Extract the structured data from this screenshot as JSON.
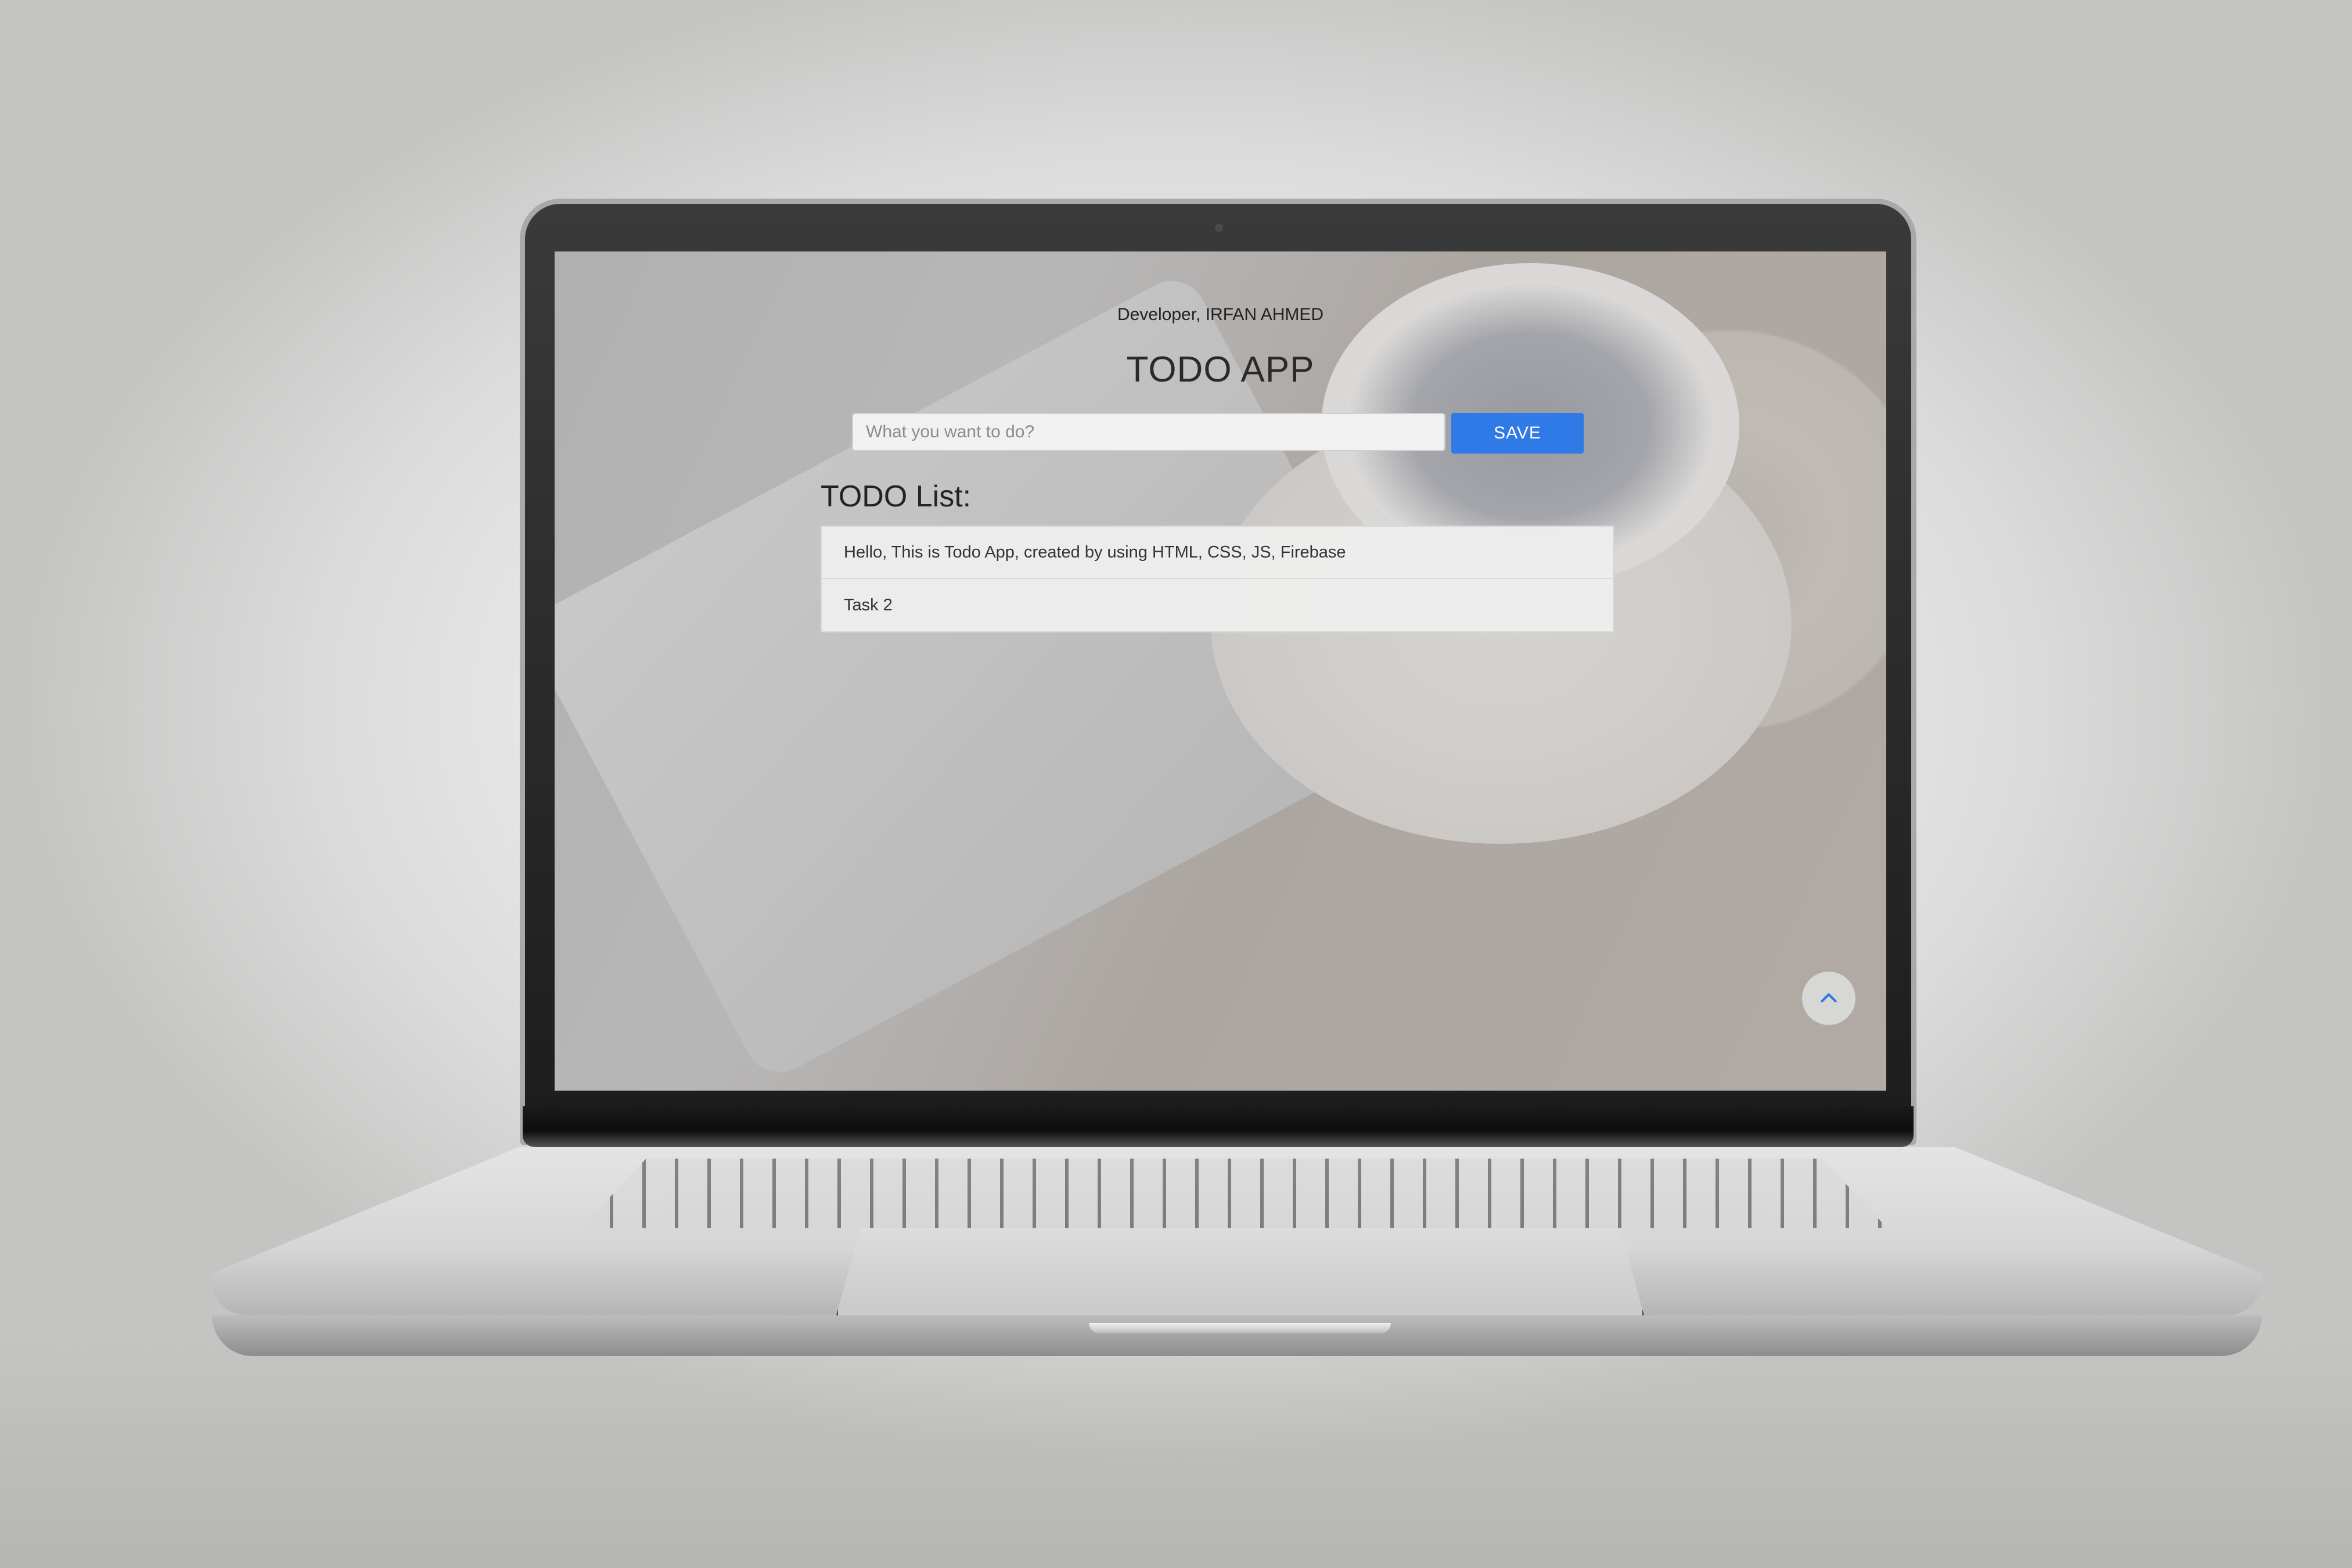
{
  "app": {
    "developer_credit": "Developer, IRFAN AHMED",
    "title": "TODO APP"
  },
  "form": {
    "input_placeholder": "What you want to do?",
    "input_value": "",
    "save_label": "SAVE"
  },
  "list": {
    "heading": "TODO List:",
    "items": [
      "Hello, This is Todo App, created by using HTML, CSS, JS, Firebase",
      "Task 2"
    ]
  },
  "icons": {
    "scroll_top": "chevron-up-icon"
  },
  "colors": {
    "accent": "#2f7ae6"
  }
}
